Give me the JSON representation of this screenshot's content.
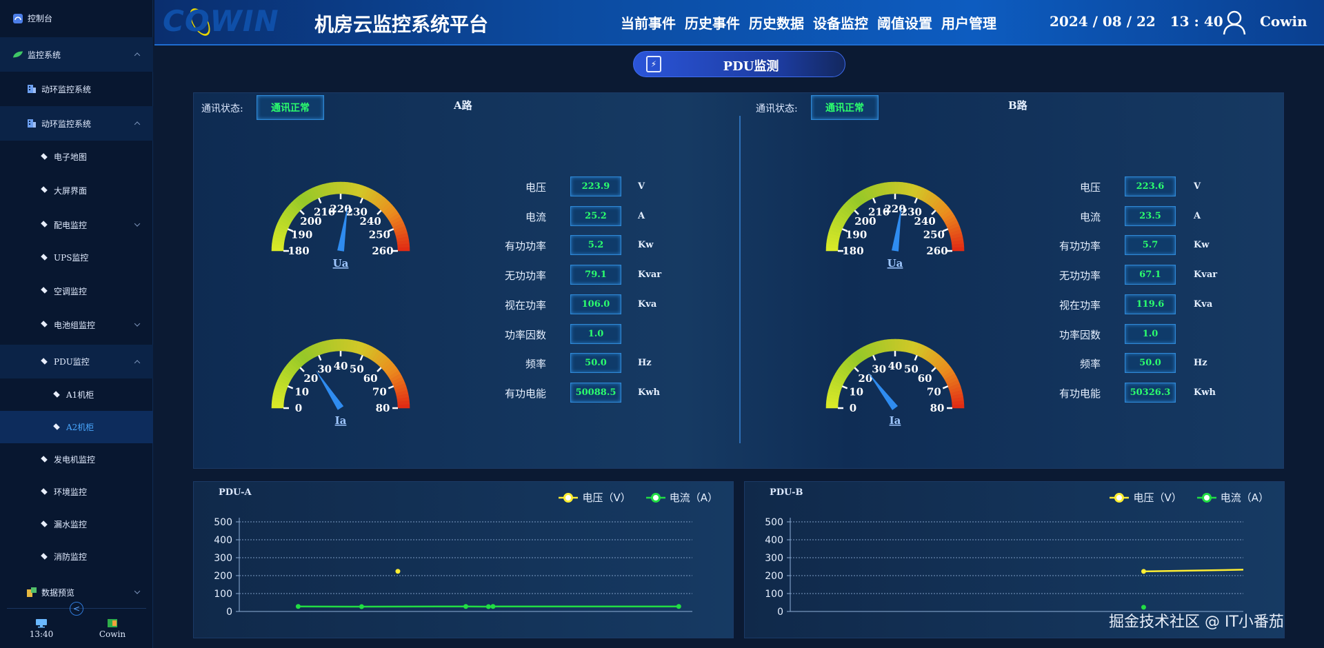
{
  "sidebar": {
    "items": [
      {
        "label": "控制台",
        "icon": "dashboard-icon",
        "level": 0
      },
      {
        "label": "监控系统",
        "icon": "leaf-icon",
        "level": 0,
        "expanded": true
      },
      {
        "label": "动环监控系统",
        "icon": "building-icon",
        "level": 1
      },
      {
        "label": "动环监控系统",
        "icon": "building-icon",
        "level": 1,
        "expanded": true
      },
      {
        "label": "电子地图",
        "icon": "diamond-icon",
        "level": 2
      },
      {
        "label": "大屏界面",
        "icon": "diamond-icon",
        "level": 2
      },
      {
        "label": "配电监控",
        "icon": "diamond-icon",
        "level": 2,
        "expanded": false
      },
      {
        "label": "UPS监控",
        "icon": "diamond-icon",
        "level": 2
      },
      {
        "label": "空调监控",
        "icon": "diamond-icon",
        "level": 2
      },
      {
        "label": "电池组监控",
        "icon": "diamond-icon",
        "level": 2,
        "expanded": false
      },
      {
        "label": "PDU监控",
        "icon": "diamond-icon",
        "level": 2,
        "expanded": true
      },
      {
        "label": "A1机柜",
        "icon": "diamond-icon",
        "level": 3
      },
      {
        "label": "A2机柜",
        "icon": "diamond-icon",
        "level": 3,
        "selected": true
      },
      {
        "label": "发电机监控",
        "icon": "diamond-icon",
        "level": 2
      },
      {
        "label": "环境监控",
        "icon": "diamond-icon",
        "level": 2
      },
      {
        "label": "漏水监控",
        "icon": "diamond-icon",
        "level": 2
      },
      {
        "label": "消防监控",
        "icon": "diamond-icon",
        "level": 2
      },
      {
        "label": "数据预览",
        "icon": "grid-icon",
        "level": 0,
        "expanded": false
      }
    ],
    "collapse_glyph": "<",
    "footer": {
      "time": "13:40",
      "user": "Cowin"
    }
  },
  "header": {
    "logo_text": "COWIN",
    "title": "机房云监控系统平台",
    "nav": [
      "当前事件",
      "历史事件",
      "历史数据",
      "设备监控",
      "阈值设置",
      "用户管理"
    ],
    "datetime": "2024 / 08 / 22   13 : 40",
    "username": "Cowin"
  },
  "page": {
    "title": "PDU监测"
  },
  "routes": [
    {
      "name": "A路",
      "comm_label": "通讯状态:",
      "comm_status": "通讯正常",
      "voltage_gauge": {
        "label": "Ua",
        "min": 180,
        "max": 260,
        "ticks": [
          180,
          190,
          200,
          210,
          220,
          230,
          240,
          250,
          260
        ],
        "value": 223.9
      },
      "current_gauge": {
        "label": "Ia",
        "min": 0,
        "max": 80,
        "ticks": [
          0,
          10,
          20,
          30,
          40,
          50,
          60,
          70,
          80
        ],
        "value": 25.2
      },
      "metrics": [
        {
          "label": "电压",
          "value": "223.9",
          "unit": "V"
        },
        {
          "label": "电流",
          "value": "25.2",
          "unit": "A"
        },
        {
          "label": "有功功率",
          "value": "5.2",
          "unit": "Kw"
        },
        {
          "label": "无功功率",
          "value": "79.1",
          "unit": "Kvar"
        },
        {
          "label": "视在功率",
          "value": "106.0",
          "unit": "Kva"
        },
        {
          "label": "功率因数",
          "value": "1.0",
          "unit": ""
        },
        {
          "label": "频率",
          "value": "50.0",
          "unit": "Hz"
        },
        {
          "label": "有功电能",
          "value": "50088.5",
          "unit": "Kwh"
        }
      ]
    },
    {
      "name": "B路",
      "comm_label": "通讯状态:",
      "comm_status": "通讯正常",
      "voltage_gauge": {
        "label": "Ua",
        "min": 180,
        "max": 260,
        "ticks": [
          180,
          190,
          200,
          210,
          220,
          230,
          240,
          250,
          260
        ],
        "value": 223.6
      },
      "current_gauge": {
        "label": "Ia",
        "min": 0,
        "max": 80,
        "ticks": [
          0,
          10,
          20,
          30,
          40,
          50,
          60,
          70,
          80
        ],
        "value": 23.5
      },
      "metrics": [
        {
          "label": "电压",
          "value": "223.6",
          "unit": "V"
        },
        {
          "label": "电流",
          "value": "23.5",
          "unit": "A"
        },
        {
          "label": "有功功率",
          "value": "5.7",
          "unit": "Kw"
        },
        {
          "label": "无功功率",
          "value": "67.1",
          "unit": "Kvar"
        },
        {
          "label": "视在功率",
          "value": "119.6",
          "unit": "Kva"
        },
        {
          "label": "功率因数",
          "value": "1.0",
          "unit": ""
        },
        {
          "label": "频率",
          "value": "50.0",
          "unit": "Hz"
        },
        {
          "label": "有功电能",
          "value": "50326.3",
          "unit": "Kwh"
        }
      ]
    }
  ],
  "colors": {
    "voltage": "#ffee33",
    "current": "#22dd44",
    "status_ok": "#2cff6e"
  },
  "chart_data": [
    {
      "type": "line",
      "title": "PDU-A",
      "ylim": [
        0,
        500
      ],
      "yticks": [
        0,
        100,
        200,
        300,
        400,
        500
      ],
      "xlim": [
        0,
        100
      ],
      "grid": true,
      "legend": "top-right",
      "series": [
        {
          "name": "电压（V）",
          "points": [
            [
              35,
              223.9
            ]
          ]
        },
        {
          "name": "电流（A）",
          "points": [
            [
              13,
              28
            ],
            [
              27,
              27
            ],
            [
              50,
              28
            ],
            [
              55,
              27
            ],
            [
              56,
              28
            ],
            [
              97,
              28
            ]
          ]
        }
      ]
    },
    {
      "type": "line",
      "title": "PDU-B",
      "ylim": [
        0,
        500
      ],
      "yticks": [
        0,
        100,
        200,
        300,
        400,
        500
      ],
      "xlim": [
        0,
        100
      ],
      "grid": true,
      "legend": "top-right",
      "series": [
        {
          "name": "电压（V）",
          "points": [
            [
              78,
              223.6
            ],
            [
              100,
              233
            ]
          ]
        },
        {
          "name": "电流（A）",
          "points": [
            [
              78,
              23.5
            ]
          ]
        }
      ]
    }
  ],
  "watermark": "掘金技术社区 @ IT小番茄"
}
